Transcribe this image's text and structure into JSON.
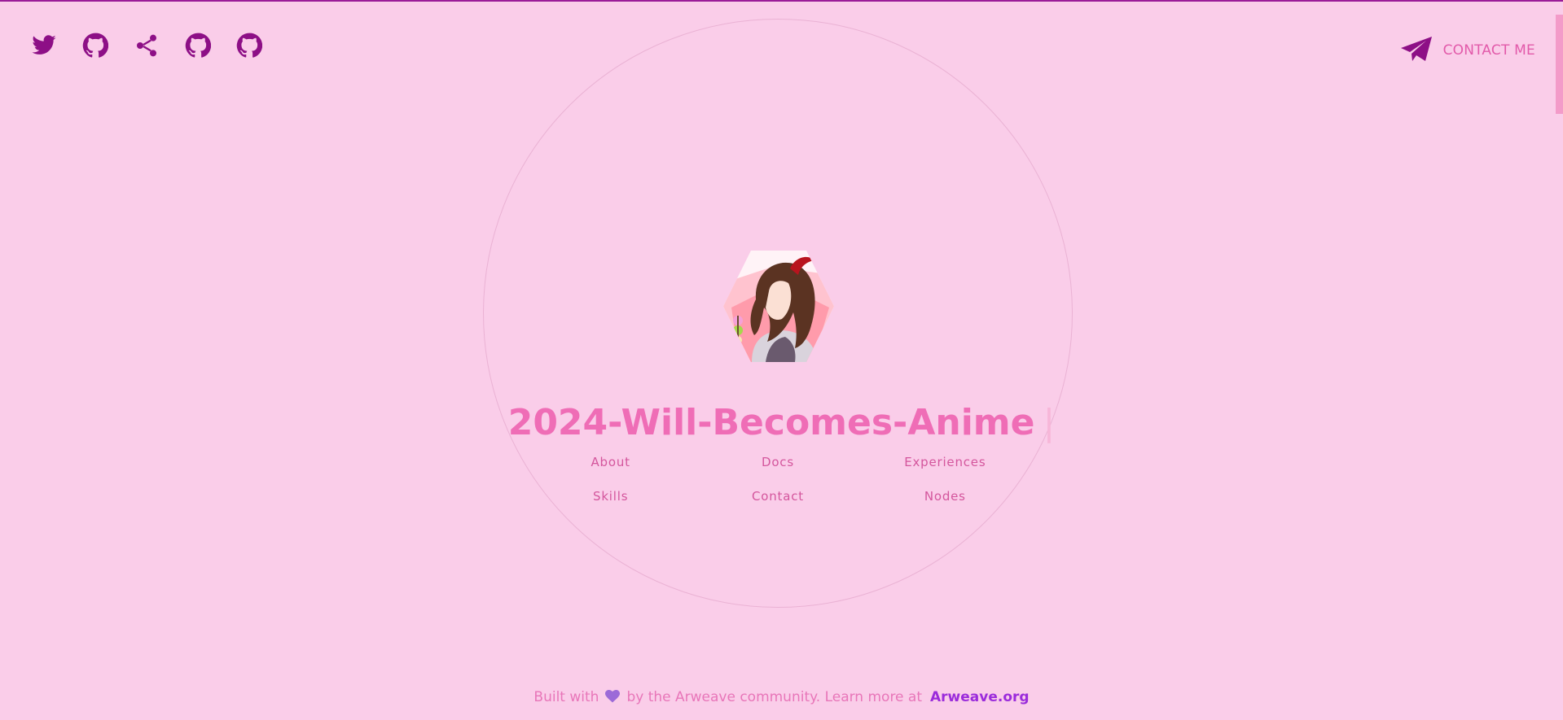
{
  "header": {
    "social_icons": [
      "twitter-icon",
      "github-icon",
      "share-icon",
      "github-icon",
      "github-icon"
    ],
    "contact_label": "CONTACT ME"
  },
  "hero": {
    "title": "2024-Will-Becomes-Anime",
    "cursor": "|"
  },
  "nav": {
    "items": [
      "About",
      "Docs",
      "Experiences",
      "Skills",
      "Contact",
      "Nodes"
    ]
  },
  "footer": {
    "prefix": "Built with",
    "middle": "by the Arweave community. Learn more at",
    "link": "Arweave.org"
  },
  "colors": {
    "background": "#facde9",
    "accent_dark": "#8d0f86",
    "accent_pink": "#ef6db6",
    "link_purple": "#9b2cdb"
  }
}
